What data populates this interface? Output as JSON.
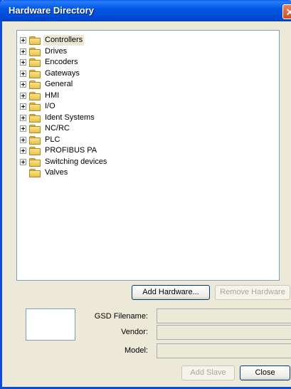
{
  "window": {
    "title": "Hardware Directory",
    "close_glyph": "✕"
  },
  "tree": {
    "items": [
      {
        "label": "Controllers",
        "expandable": true,
        "selected": true
      },
      {
        "label": "Drives",
        "expandable": true
      },
      {
        "label": "Encoders",
        "expandable": true
      },
      {
        "label": "Gateways",
        "expandable": true
      },
      {
        "label": "General",
        "expandable": true
      },
      {
        "label": "HMI",
        "expandable": true
      },
      {
        "label": "I/O",
        "expandable": true
      },
      {
        "label": "Ident Systems",
        "expandable": true
      },
      {
        "label": "NC/RC",
        "expandable": true
      },
      {
        "label": "PLC",
        "expandable": true
      },
      {
        "label": "PROFIBUS PA",
        "expandable": true
      },
      {
        "label": "Switching devices",
        "expandable": true
      },
      {
        "label": "Valves",
        "expandable": false
      }
    ]
  },
  "buttons": {
    "add_hardware": "Add Hardware...",
    "remove_hardware": "Remove Hardware",
    "add_slave": "Add Slave",
    "close": "Close"
  },
  "fields": {
    "gsd_filename_label": "GSD Filename:",
    "gsd_filename_value": "",
    "vendor_label": "Vendor:",
    "vendor_value": "",
    "model_label": "Model:",
    "model_value": ""
  }
}
